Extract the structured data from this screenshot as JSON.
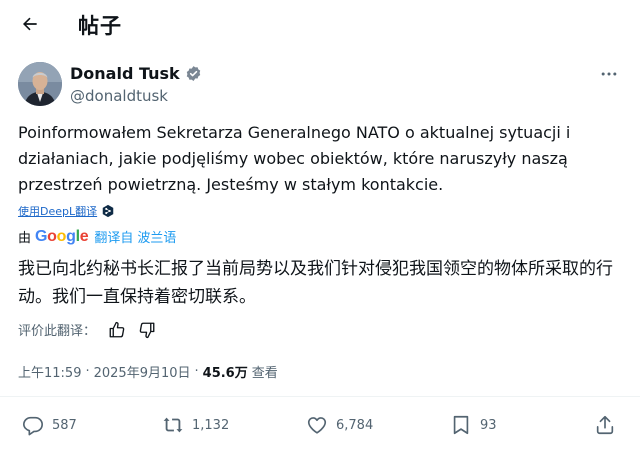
{
  "header": {
    "title": "帖子"
  },
  "author": {
    "name": "Donald Tusk",
    "handle": "@donaldtusk"
  },
  "post": {
    "text": "Poinformowałem Sekretarza Generalnego NATO o aktualnej sytuacji i działaniach, jakie podjęliśmy wobec obiektów, które naruszyły naszą przestrzeń powietrzną. Jesteśmy w stałym kontakcie."
  },
  "deepl": {
    "label": "使用DeepL翻译"
  },
  "google_translate": {
    "by": "由",
    "logo": [
      "G",
      "o",
      "o",
      "g",
      "l",
      "e"
    ],
    "logo_colors": [
      "#4285F4",
      "#EA4335",
      "#FBBC05",
      "#4285F4",
      "#34A853",
      "#EA4335"
    ],
    "translated_from": "翻译自",
    "language": "波兰语"
  },
  "translation": {
    "text": "我已向北约秘书长汇报了当前局势以及我们针对侵犯我国领空的物体所采取的行动。我们一直保持着密切联系。"
  },
  "rate": {
    "label": "评价此翻译："
  },
  "meta": {
    "time": "上午11:59",
    "separator": "·",
    "date": "2025年9月10日",
    "views_count": "45.6万",
    "views_label": "查看"
  },
  "actions": {
    "replies": "587",
    "reposts": "1,132",
    "likes": "6,784",
    "bookmarks": "93"
  },
  "colors": {
    "accent": "#1d9bf0",
    "text": "#0f1419",
    "muted": "#536471",
    "divider": "#eff3f4",
    "deepl_link": "#1d68c9"
  }
}
